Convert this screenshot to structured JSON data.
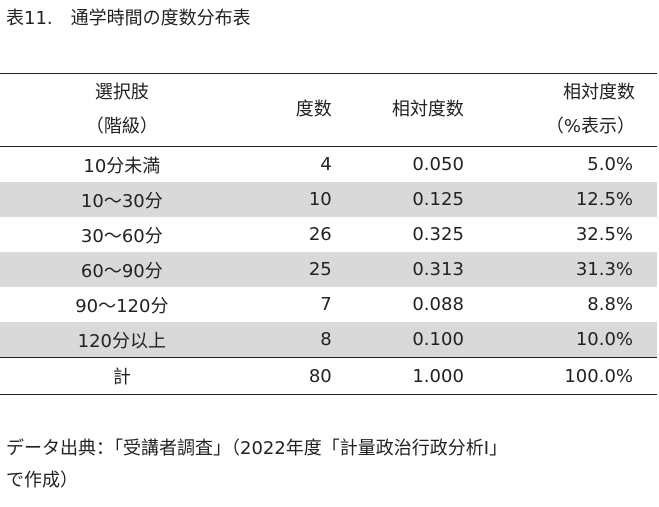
{
  "caption": {
    "number": "表11.",
    "title": "通学時間の度数分布表"
  },
  "table": {
    "headers": {
      "class_line1": "選択肢",
      "class_line2": "（階級）",
      "frequency": "度数",
      "relative": "相対度数",
      "percent_line1": "相対度数",
      "percent_line2": "（%表示）"
    },
    "rows": [
      {
        "class": "10分未満",
        "frequency": "4",
        "relative": "0.050",
        "percent": "5.0%"
      },
      {
        "class": "10〜30分",
        "frequency": "10",
        "relative": "0.125",
        "percent": "12.5%"
      },
      {
        "class": "30〜60分",
        "frequency": "26",
        "relative": "0.325",
        "percent": "32.5%"
      },
      {
        "class": "60〜90分",
        "frequency": "25",
        "relative": "0.313",
        "percent": "31.3%"
      },
      {
        "class": "90〜120分",
        "frequency": "7",
        "relative": "0.088",
        "percent": "8.8%"
      },
      {
        "class": "120分以上",
        "frequency": "8",
        "relative": "0.100",
        "percent": "10.0%"
      }
    ],
    "total": {
      "class": "計",
      "frequency": "80",
      "relative": "1.000",
      "percent": "100.0%"
    },
    "shade_color": "#d9d9d9"
  },
  "source": {
    "line1": "データ出典：「受講者調査」（2022年度「計量政治行政分析Ⅰ」",
    "line2": "で作成）"
  }
}
